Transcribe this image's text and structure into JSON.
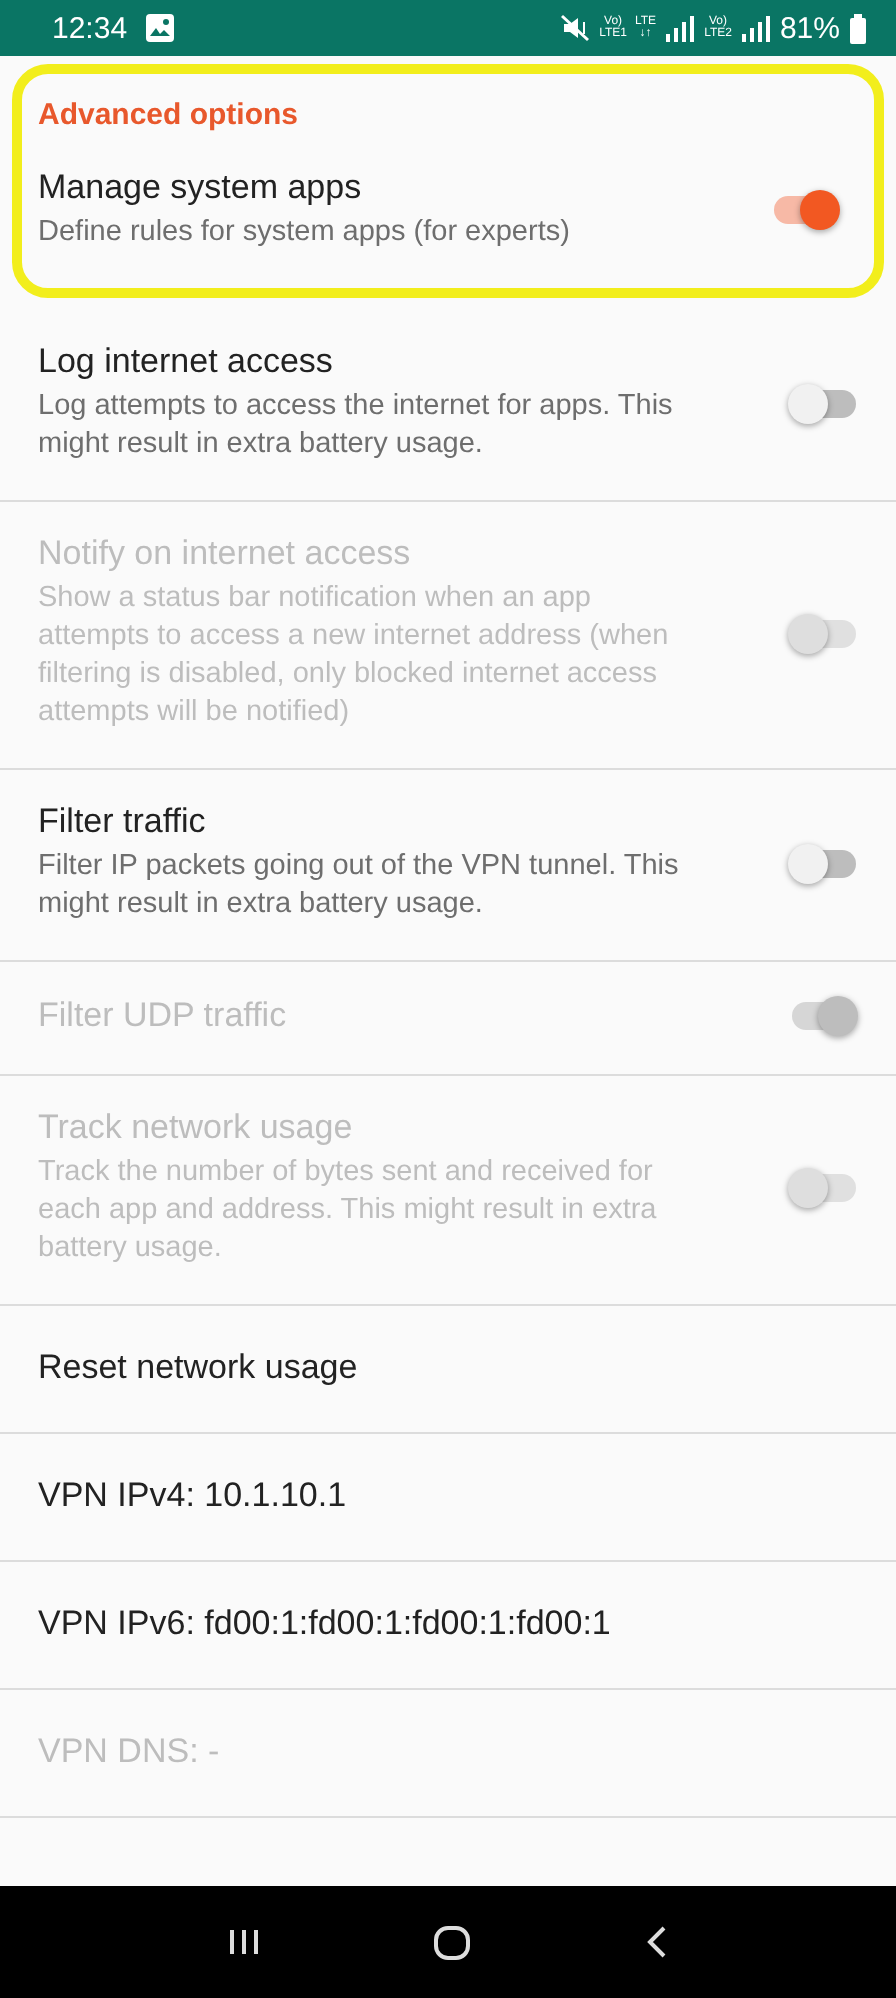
{
  "status_bar": {
    "time": "12:34",
    "network_labels": [
      {
        "top": "Vo)",
        "bottom": "LTE1"
      },
      {
        "top": "LTE",
        "bottom": "↓↑"
      },
      {
        "top": "Vo)",
        "bottom": "LTE2"
      }
    ],
    "battery": "81%"
  },
  "category": {
    "title": "Advanced options",
    "highlighted": true
  },
  "items": [
    {
      "kind": "toggle",
      "title": "Manage system apps",
      "summary": "Define rules for system apps (for experts)",
      "on": true,
      "disabled": false,
      "highlighted": true
    },
    {
      "kind": "toggle",
      "title": "Log internet access",
      "summary": "Log attempts to access the internet for apps. This might result in extra battery usage.",
      "on": false,
      "disabled": false,
      "highlighted": false
    },
    {
      "kind": "toggle",
      "title": "Notify on internet access",
      "summary": "Show a status bar notification when an app attempts to access a new internet address (when filtering is disabled, only blocked internet access attempts will be notified)",
      "on": false,
      "disabled": true,
      "highlighted": false
    },
    {
      "kind": "toggle",
      "title": "Filter traffic",
      "summary": "Filter IP packets going out of the VPN tunnel. This might result in extra battery usage.",
      "on": false,
      "disabled": false,
      "highlighted": false
    },
    {
      "kind": "toggle",
      "title": "Filter UDP traffic",
      "on": true,
      "disabled": true,
      "highlighted": false
    },
    {
      "kind": "toggle",
      "title": "Track network usage",
      "summary": "Track the number of bytes sent and received for each app and address. This might result in extra battery usage.",
      "on": false,
      "disabled": true,
      "highlighted": false
    },
    {
      "kind": "plain",
      "title": "Reset network usage",
      "disabled": false,
      "highlighted": false
    },
    {
      "kind": "plain",
      "title": "VPN IPv4: 10.1.10.1",
      "disabled": false,
      "highlighted": false
    },
    {
      "kind": "plain",
      "title": "VPN IPv6: fd00:1:fd00:1:fd00:1:fd00:1",
      "disabled": false,
      "highlighted": false
    },
    {
      "kind": "plain",
      "title": "VPN DNS: -",
      "disabled": true,
      "highlighted": false
    }
  ]
}
